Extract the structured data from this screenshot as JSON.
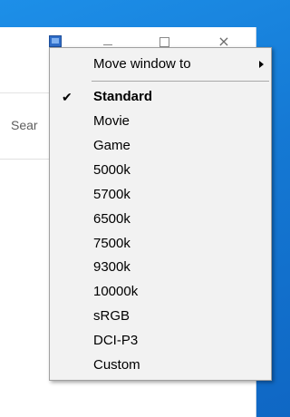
{
  "window": {
    "search_placeholder": "Sear"
  },
  "menu": {
    "move_window_label": "Move window to",
    "selected_preset": "Standard",
    "presets": [
      "Standard",
      "Movie",
      "Game",
      "5000k",
      "5700k",
      "6500k",
      "7500k",
      "9300k",
      "10000k",
      "sRGB",
      "DCI-P3",
      "Custom"
    ]
  },
  "icons": {
    "check": "checkmark-icon",
    "submenu": "submenu-arrow-icon",
    "close_glyph": "×"
  },
  "colors": {
    "desktop": "#1579d4",
    "menu_background": "#f2f2f2"
  }
}
